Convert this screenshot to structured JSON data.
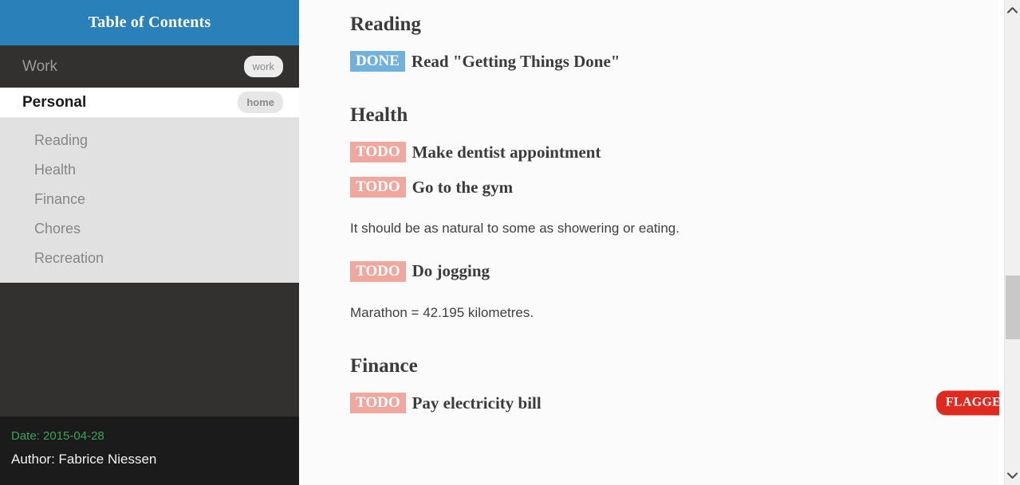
{
  "sidebar": {
    "header_title": "Table of Contents",
    "top_items": [
      {
        "label": "Work",
        "tag": "work"
      },
      {
        "label": "Personal",
        "tag": "home"
      }
    ],
    "subitems": [
      {
        "label": "Reading"
      },
      {
        "label": "Health"
      },
      {
        "label": "Finance"
      },
      {
        "label": "Chores"
      },
      {
        "label": "Recreation"
      }
    ],
    "footer": {
      "date": "Date: 2015-04-28",
      "author": "Author: Fabrice Niessen"
    }
  },
  "content": {
    "sections": [
      {
        "heading": "Reading",
        "items": [
          {
            "keyword": "DONE",
            "title": "Read \"Getting Things Done\""
          }
        ]
      },
      {
        "heading": "Health",
        "items": [
          {
            "keyword": "TODO",
            "title": "Make dentist appointment"
          },
          {
            "keyword": "TODO",
            "title": "Go to the gym"
          }
        ],
        "paragraph_1": "It should be as natural to some as showering or eating.",
        "items_2": [
          {
            "keyword": "TODO",
            "title": "Do jogging"
          }
        ],
        "paragraph_2": "Marathon = 42.195 kilometres."
      },
      {
        "heading": "Finance",
        "items": [
          {
            "keyword": "TODO",
            "title": "Pay electricity bill",
            "flag": "FLAGGED"
          }
        ]
      }
    ]
  },
  "scrollbar": {
    "up_icon": "chevron-up-icon",
    "down_icon": "chevron-down-icon"
  },
  "colors": {
    "header_blue": "#2a80b9",
    "sidebar_dark": "#333130",
    "sidebar_footer": "#1c1b1b",
    "sublist_gray": "#e1e1e1",
    "done_blue": "#71b2dd",
    "todo_red": "#f0a79e",
    "flag_red": "#e0291f",
    "date_green": "#36a55c"
  }
}
